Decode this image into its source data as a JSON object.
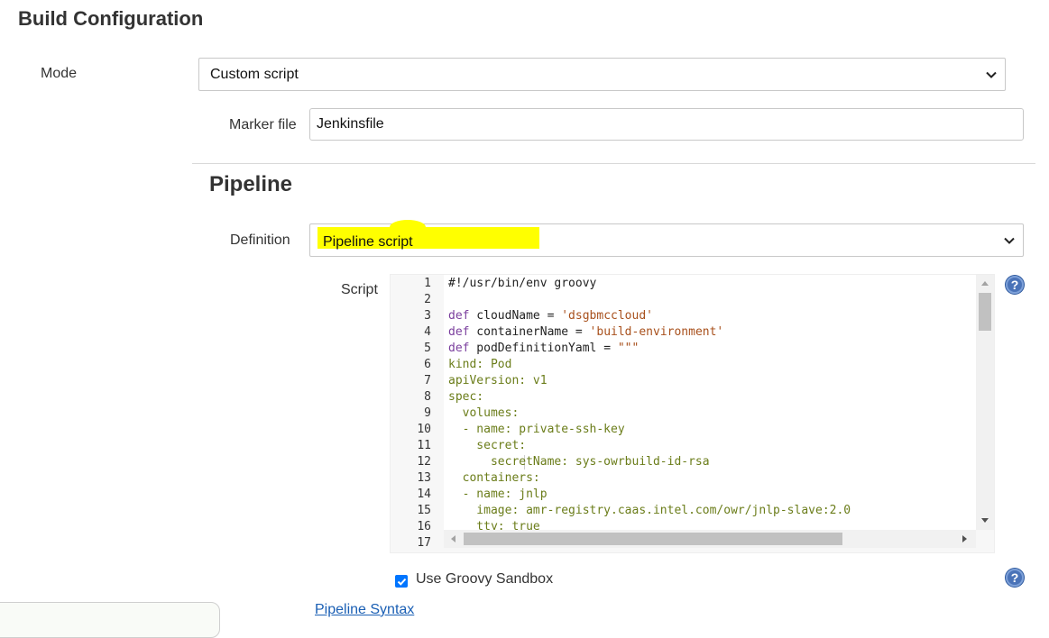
{
  "section": {
    "title": "Build Configuration"
  },
  "mode": {
    "label": "Mode",
    "selected": "Custom script"
  },
  "marker": {
    "label": "Marker file",
    "value": "Jenkinsfile"
  },
  "pipeline": {
    "title": "Pipeline",
    "definition_label": "Definition",
    "definition_selected": "Pipeline script",
    "script_label": "Script",
    "sandbox_label": "Use Groovy Sandbox",
    "sandbox_checked": true,
    "syntax_link": "Pipeline Syntax"
  },
  "editor": {
    "line_numbers": [
      "1",
      "2",
      "3",
      "4",
      "5",
      "6",
      "7",
      "8",
      "9",
      "10",
      "11",
      "12",
      "13",
      "14",
      "15",
      "16",
      "17"
    ],
    "lines": [
      [
        {
          "t": "#!/usr/bin/env groovy",
          "c": "plain"
        }
      ],
      [],
      [
        {
          "t": "def",
          "c": "kw"
        },
        {
          "t": " cloudName = ",
          "c": "plain"
        },
        {
          "t": "'dsgbmccloud'",
          "c": "str"
        }
      ],
      [
        {
          "t": "def",
          "c": "kw"
        },
        {
          "t": " containerName = ",
          "c": "plain"
        },
        {
          "t": "'build-environment'",
          "c": "str"
        }
      ],
      [
        {
          "t": "def",
          "c": "kw"
        },
        {
          "t": " podDefinitionYaml = ",
          "c": "plain"
        },
        {
          "t": "\"\"\"",
          "c": "str"
        }
      ],
      [
        {
          "t": "kind: Pod",
          "c": "yaml"
        }
      ],
      [
        {
          "t": "apiVersion: v1",
          "c": "yaml"
        }
      ],
      [
        {
          "t": "spec:",
          "c": "yaml"
        }
      ],
      [
        {
          "t": "  volumes:",
          "c": "yaml"
        }
      ],
      [
        {
          "t": "  - name: private-ssh-key",
          "c": "yaml"
        }
      ],
      [
        {
          "t": "    secret:",
          "c": "yaml"
        }
      ],
      [
        {
          "t": "      secretName: sys-owrbuild-id-rsa",
          "c": "yaml"
        }
      ],
      [
        {
          "t": "  containers:",
          "c": "yaml"
        }
      ],
      [
        {
          "t": "  - name: jnlp",
          "c": "yaml"
        }
      ],
      [
        {
          "t": "    image: amr-registry.caas.intel.com/owr/jnlp-slave:2.0",
          "c": "yaml"
        }
      ],
      [
        {
          "t": "    tty: true",
          "c": "yaml"
        }
      ],
      []
    ]
  },
  "icons": {
    "help": "help-icon",
    "chevron": "chevron-down-icon",
    "check": "checkmark-icon"
  },
  "help_glyph": "?",
  "colors": {
    "highlight": "#ffff00",
    "keyword": "#7a3e9d",
    "string": "#a8501c",
    "yaml": "#6b7d1a",
    "help": "#4a73b8",
    "link": "#1a5fb4"
  }
}
